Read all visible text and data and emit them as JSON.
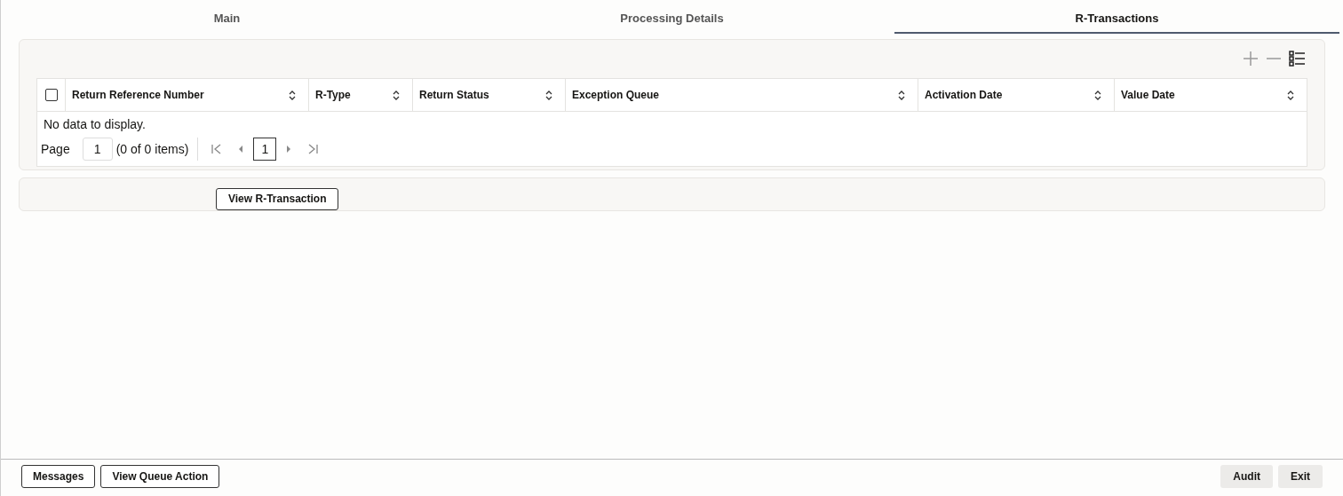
{
  "tabs": [
    {
      "label": "Main",
      "selected": false
    },
    {
      "label": "Processing Details",
      "selected": false
    },
    {
      "label": "R-Transactions",
      "selected": true
    }
  ],
  "table": {
    "select_all_checked": false,
    "columns": [
      {
        "label": "Return Reference Number"
      },
      {
        "label": "R-Type"
      },
      {
        "label": "Return Status"
      },
      {
        "label": "Exception Queue"
      },
      {
        "label": "Activation Date"
      },
      {
        "label": "Value Date"
      }
    ],
    "empty_message": "No data to display.",
    "pagination": {
      "page_label": "Page",
      "page_value": "1",
      "summary": "(0 of 0 items)",
      "current_page": "1"
    }
  },
  "actions": [
    "View R-Transaction"
  ],
  "footer_left": [
    "Messages",
    "View Queue Action"
  ],
  "footer_right": [
    "Audit",
    "Exit"
  ]
}
